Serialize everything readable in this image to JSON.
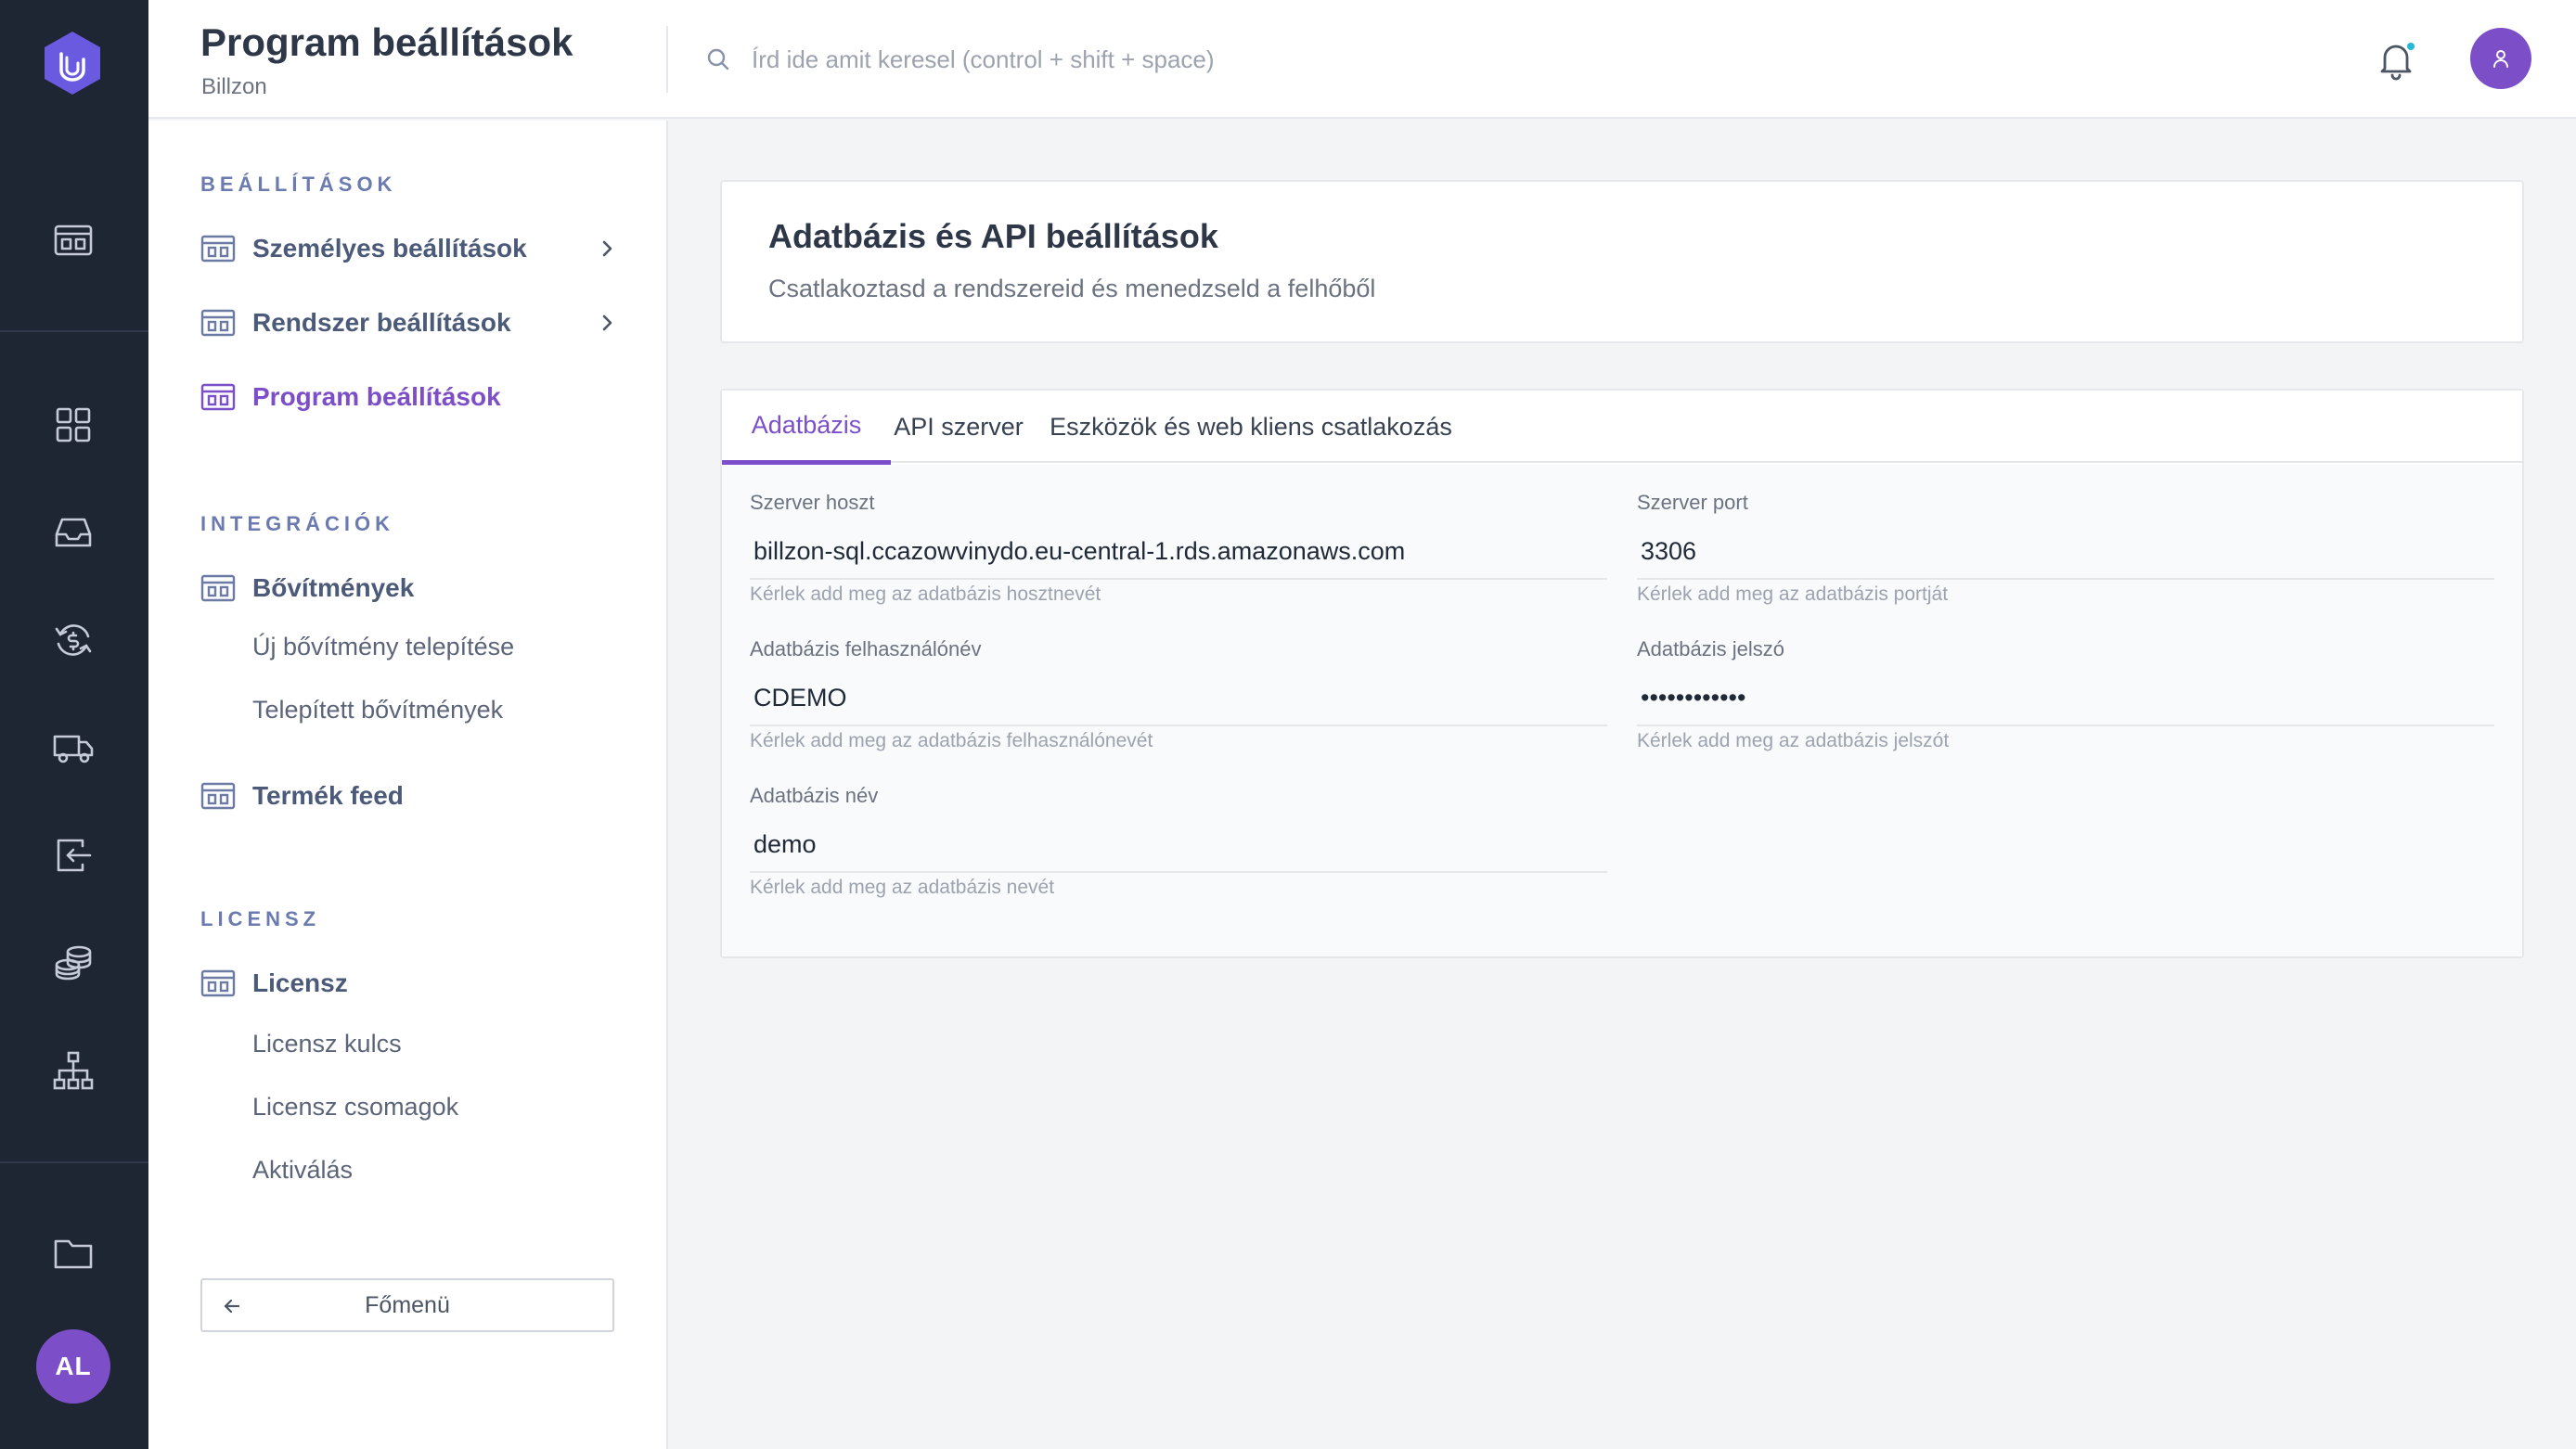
{
  "header": {
    "title": "Program beállítások",
    "subtitle": "Billzon",
    "search_placeholder": "Írd ide amit keresel (control + shift + space)"
  },
  "rail": {
    "avatar_initials": "AL",
    "icons": [
      "logo-icon",
      "dashboard-icon",
      "grid-icon",
      "inbox-icon",
      "currency-exchange-icon",
      "truck-icon",
      "receipt-icon",
      "coins-icon",
      "sitemap-icon",
      "folder-icon"
    ]
  },
  "sidebar": {
    "sections": [
      {
        "title": "BEÁLLÍTÁSOK",
        "items": [
          {
            "label": "Személyes beállítások"
          },
          {
            "label": "Rendszer beállítások"
          },
          {
            "label": "Program beállítások",
            "active": true
          }
        ]
      },
      {
        "title": "INTEGRÁCIÓK",
        "items": [
          {
            "label": "Bővítmények",
            "children": [
              "Új bővítmény telepítése",
              "Telepített bővítmények"
            ]
          },
          {
            "label": "Termék feed"
          }
        ]
      },
      {
        "title": "LICENSZ",
        "items": [
          {
            "label": "Licensz",
            "children": [
              "Licensz kulcs",
              "Licensz csomagok",
              "Aktiválás"
            ]
          }
        ]
      }
    ],
    "back_label": "Főmenü"
  },
  "main": {
    "card_title": "Adatbázis és API beállítások",
    "card_desc": "Csatlakoztasd a rendszereid és menedzseld a felhőből",
    "tabs": [
      {
        "label": "Adatbázis",
        "active": true
      },
      {
        "label": "API szerver"
      },
      {
        "label": "Eszközök és web kliens csatlakozás"
      }
    ],
    "fields": {
      "host": {
        "label": "Szerver hoszt",
        "value": "billzon-sql.ccazowvinydo.eu-central-1.rds.amazonaws.com",
        "help": "Kérlek add meg az adatbázis hosztnevét"
      },
      "port": {
        "label": "Szerver port",
        "value": "3306",
        "help": "Kérlek add meg az adatbázis portját"
      },
      "user": {
        "label": "Adatbázis felhasználónév",
        "value": "CDEMO",
        "help": "Kérlek add meg az adatbázis felhasználónevét"
      },
      "password": {
        "label": "Adatbázis jelszó",
        "value": "••••••••••••",
        "help": "Kérlek add meg az adatbázis jelszót"
      },
      "dbname": {
        "label": "Adatbázis név",
        "value": "demo",
        "help": "Kérlek add meg az adatbázis nevét"
      }
    }
  },
  "colors": {
    "accent": "#7c4fc9",
    "rail_bg": "#1e2533",
    "notification_dot": "#22b8d6"
  }
}
